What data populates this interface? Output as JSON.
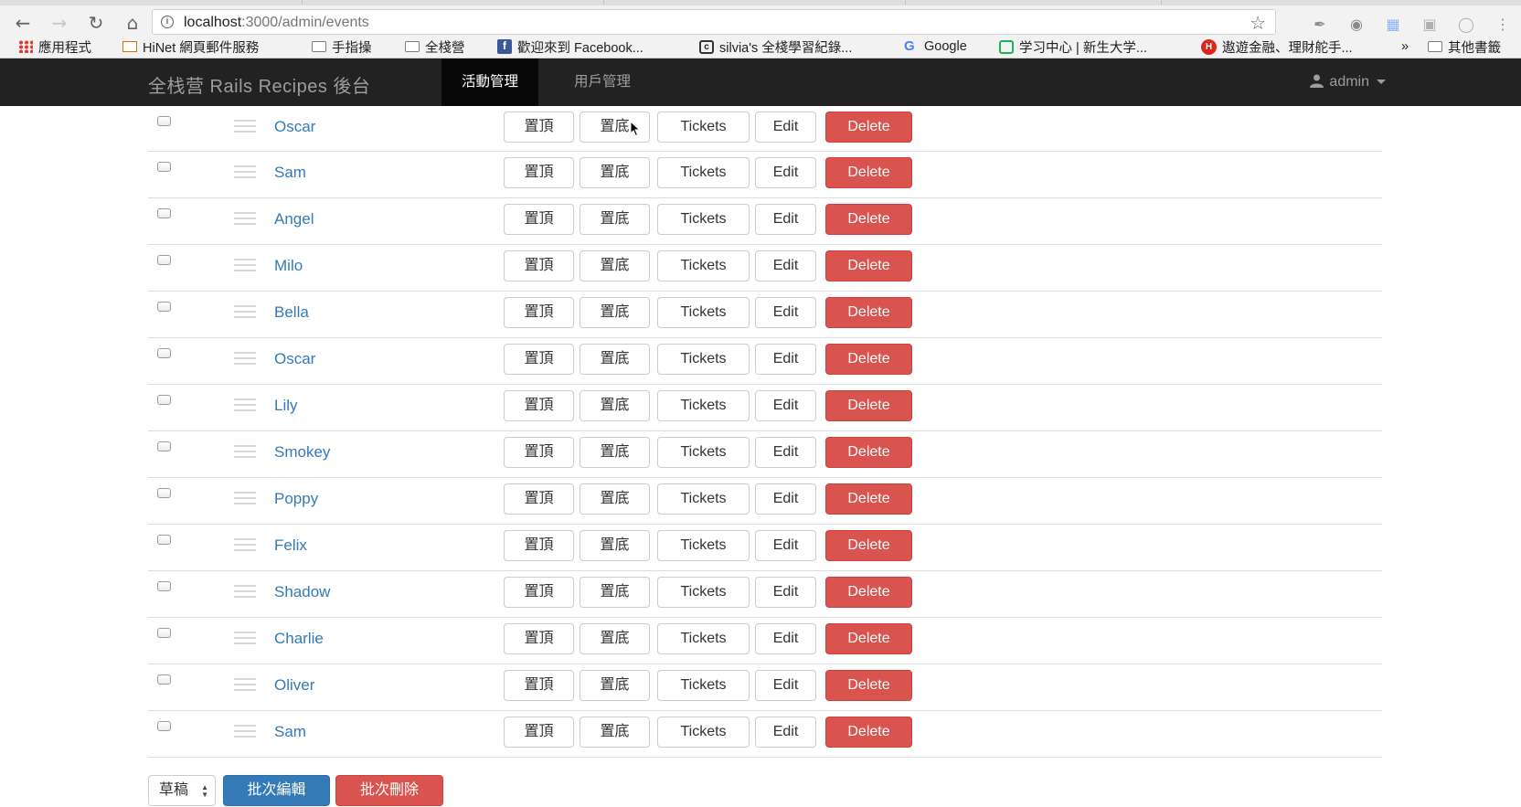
{
  "browser": {
    "url_host": "localhost",
    "url_path": ":3000/admin/events",
    "bookmarks": [
      {
        "label": "應用程式",
        "icon": "apps-grid-icon"
      },
      {
        "label": "HiNet 網頁郵件服務",
        "icon": "mail-icon"
      },
      {
        "label": "手指操",
        "icon": "folder-icon"
      },
      {
        "label": "全棧營",
        "icon": "folder-icon"
      },
      {
        "label": "歡迎來到 Facebook...",
        "icon": "facebook-icon"
      },
      {
        "label": "silvia's 全棧學習紀錄...",
        "icon": "site-icon"
      },
      {
        "label": "Google",
        "icon": "google-icon"
      },
      {
        "label": "学习中心 | 新生大学...",
        "icon": "site-icon"
      },
      {
        "label": "遨遊金融、理財舵手...",
        "icon": "site-icon"
      },
      {
        "label": "»",
        "icon": "more-bookmarks-icon"
      },
      {
        "label": "其他書籤",
        "icon": "folder-icon"
      }
    ]
  },
  "navbar": {
    "brand": "全栈营 Rails Recipes 後台",
    "items": [
      {
        "label": "活動管理",
        "active": true
      },
      {
        "label": "用戶管理",
        "active": false
      }
    ],
    "user": "admin"
  },
  "table": {
    "actions": {
      "top": "置頂",
      "bottom": "置底",
      "tickets": "Tickets",
      "edit": "Edit",
      "delete": "Delete"
    },
    "rows": [
      {
        "name": "Oscar"
      },
      {
        "name": "Sam"
      },
      {
        "name": "Angel"
      },
      {
        "name": "Milo"
      },
      {
        "name": "Bella"
      },
      {
        "name": "Oscar"
      },
      {
        "name": "Lily"
      },
      {
        "name": "Smokey"
      },
      {
        "name": "Poppy"
      },
      {
        "name": "Felix"
      },
      {
        "name": "Shadow"
      },
      {
        "name": "Charlie"
      },
      {
        "name": "Oliver"
      },
      {
        "name": "Sam"
      }
    ]
  },
  "footer": {
    "status_select": "草稿",
    "batch_edit": "批次編輯",
    "batch_delete": "批次刪除"
  },
  "colors": {
    "link": "#337ab7",
    "danger": "#d9534f",
    "primary": "#337ab7",
    "navbar": "#222222"
  }
}
